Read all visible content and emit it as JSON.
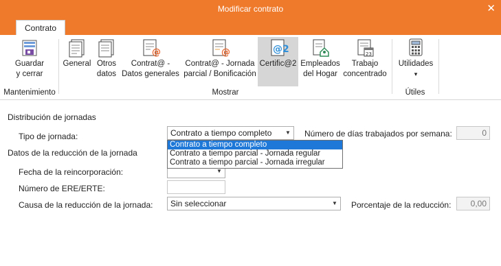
{
  "window": {
    "title": "Modificar contrato",
    "close_glyph": "✕"
  },
  "tabs": [
    {
      "label": "Contrato",
      "active": true
    }
  ],
  "ribbon": {
    "buttons": [
      {
        "line1": "Guardar",
        "line2": "y cerrar",
        "icon": "save-icon"
      },
      {
        "line1": "General",
        "line2": "",
        "icon": "document-icon"
      },
      {
        "line1": "Otros",
        "line2": "datos",
        "icon": "document-icon"
      },
      {
        "line1": "Contrat@ -",
        "line2": "Datos generales",
        "icon": "contrata-icon"
      },
      {
        "line1": "Contrat@ - Jornada",
        "line2": "parcial / Bonificación",
        "icon": "contrata-icon"
      },
      {
        "line1": "Certific@2",
        "line2": "",
        "icon": "certifica-icon"
      },
      {
        "line1": "Empleados",
        "line2": "del Hogar",
        "icon": "house-user-icon"
      },
      {
        "line1": "Trabajo",
        "line2": "concentrado",
        "icon": "calendar-document-icon"
      },
      {
        "line1": "Utilidades",
        "line2": "▾",
        "icon": "calculator-icon"
      }
    ],
    "groups": [
      "Mantenimiento",
      "Mostrar",
      "Útiles"
    ]
  },
  "form": {
    "section1": "Distribución de jornadas",
    "tipo_label": "Tipo de jornada:",
    "tipo_value": "Contrato a tiempo completo",
    "dias_label": "Número de días trabajados por semana:",
    "dias_value": "0",
    "section2": "Datos de la reducción de la jornada",
    "fecha_label": "Fecha de la reincorporación:",
    "ere_label": "Número de ERE/ERTE:",
    "causa_label": "Causa de la reducción de la jornada:",
    "causa_value": "Sin seleccionar",
    "porcentaje_label": "Porcentaje de la reducción:",
    "porcentaje_value": "0,00"
  },
  "dropdown": {
    "options": [
      "Contrato a tiempo completo",
      "Contrato a tiempo parcial - Jornada regular",
      "Contrato a tiempo parcial - Jornada irregular"
    ],
    "selected_index": 0
  },
  "colors": {
    "accent": "#ef7a2c",
    "selection": "#1e78d7"
  }
}
